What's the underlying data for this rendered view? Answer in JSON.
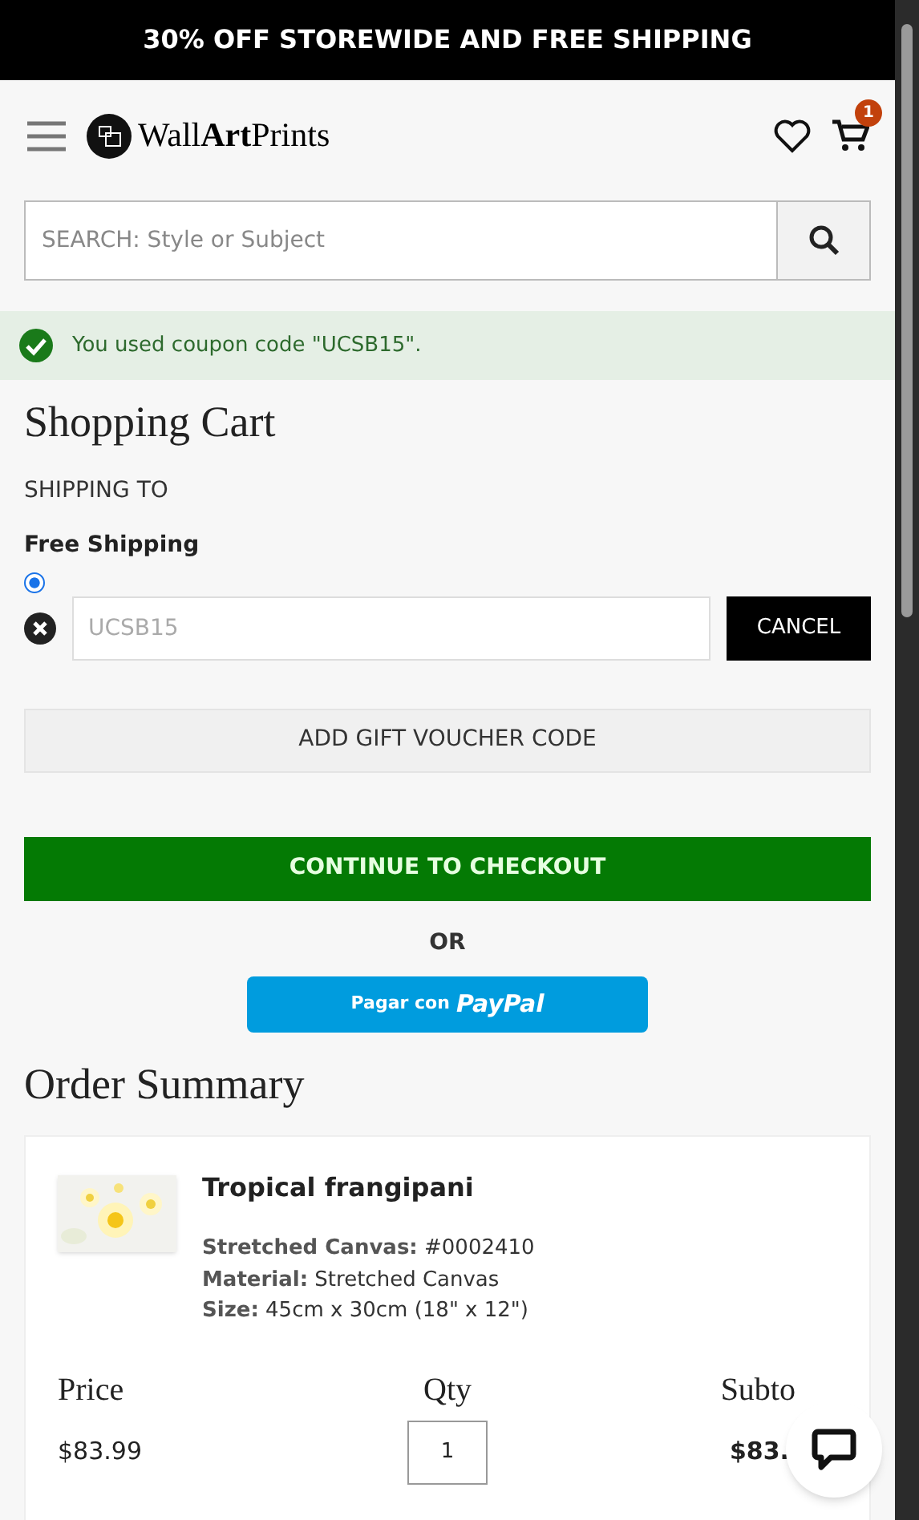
{
  "promo_banner": "30% OFF STOREWIDE AND FREE SHIPPING",
  "header": {
    "logo": "Wall**Art**Prints",
    "cart_count": "1"
  },
  "search": {
    "placeholder": "SEARCH: Style or Subject"
  },
  "notice": "You used coupon code \"UCSB15\".",
  "cart": {
    "title": "Shopping Cart",
    "shipping_label": "SHIPPING TO",
    "shipping_method": "Free Shipping",
    "shipping_selected": true,
    "coupon": {
      "placeholder": "UCSB15",
      "cancel": "CANCEL"
    },
    "gift_voucher": "ADD GIFT VOUCHER CODE",
    "checkout": "CONTINUE TO CHECKOUT",
    "or": "OR",
    "paypal_prefix": "Pagar con",
    "paypal_brand": "PayPal"
  },
  "order_summary": {
    "title": "Order Summary",
    "item": {
      "kind": "picture",
      "name": "Tropical frangipani",
      "details": [
        "**Stretched Canvas:** #0002410",
        "**Material:** Stretched Canvas",
        "**Size:** 45cm x 30cm (18\" x 12\")"
      ]
    },
    "columns": [
      "Price",
      "Qty",
      "Subto"
    ],
    "row": {
      "price": "$83.99",
      "qty": "1",
      "subtotal": "$83."
    }
  }
}
